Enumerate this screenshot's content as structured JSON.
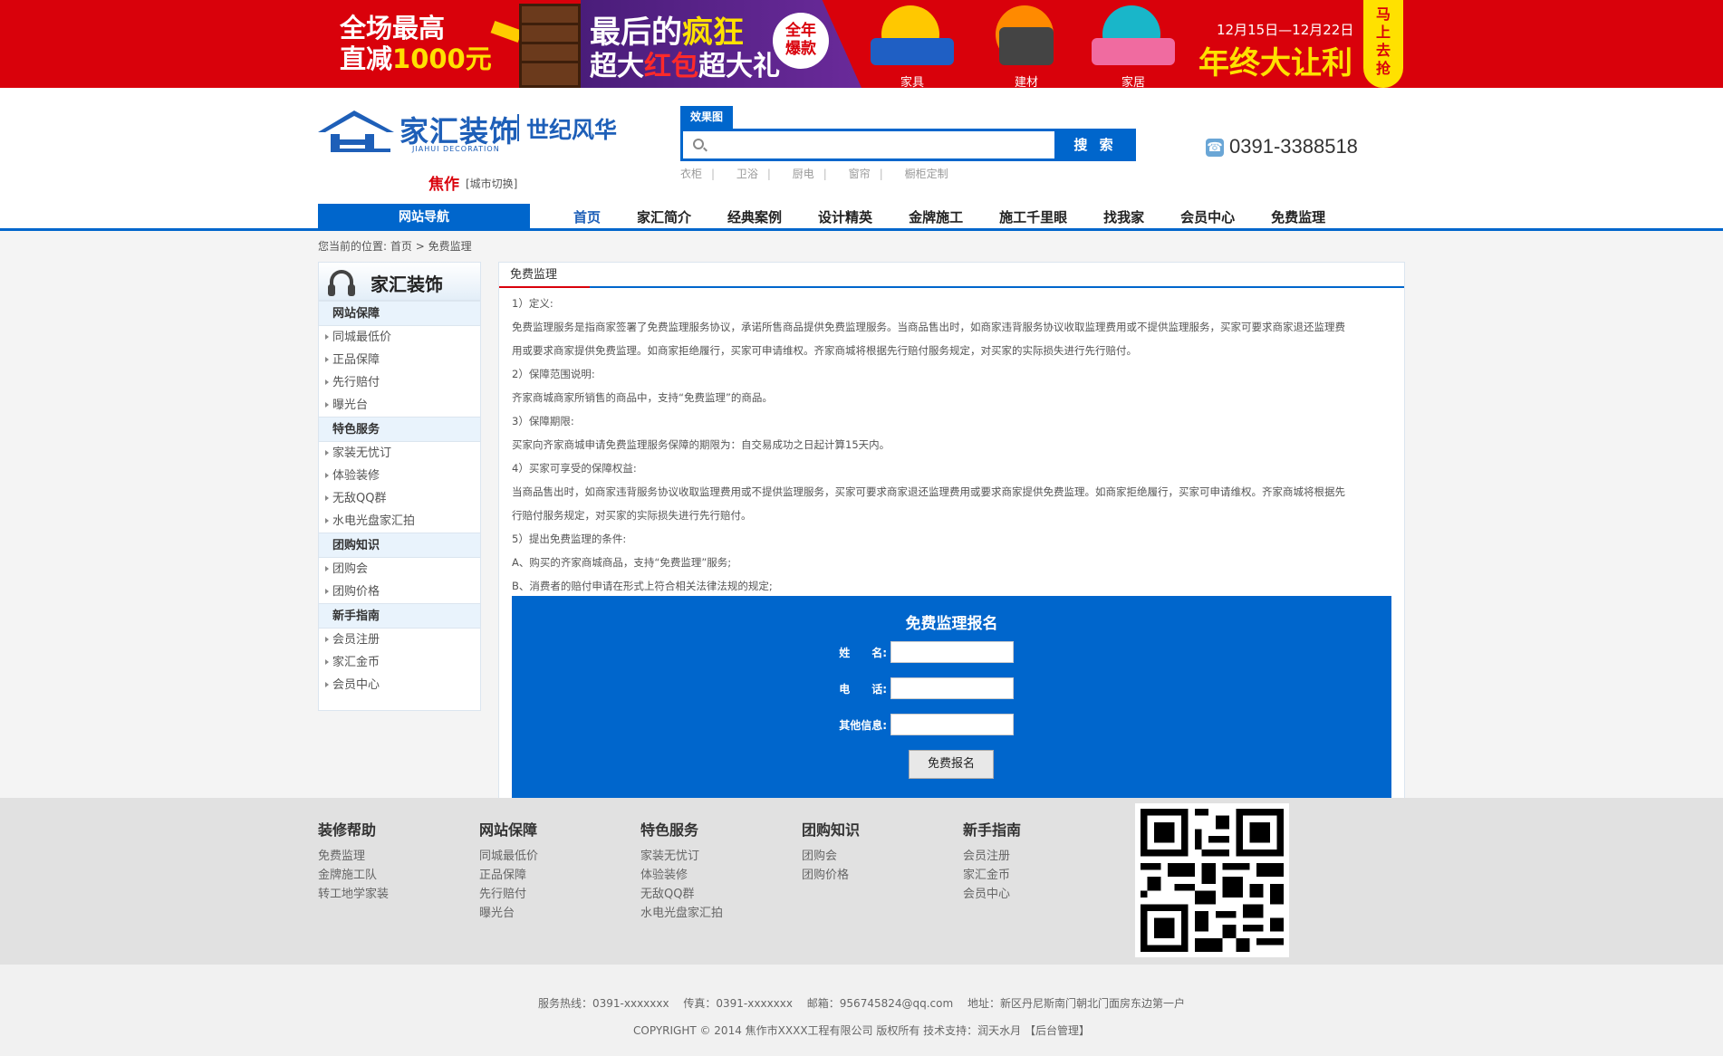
{
  "banner": {
    "promo_line1": "全场最高",
    "promo_line2_prefix": "直减",
    "promo_line2_amount": "1000元",
    "headline_a": "最后的",
    "headline_b": "疯狂",
    "subline_a": "超大",
    "subline_b": "红包",
    "subline_c": "超大礼",
    "badge_line1": "全年",
    "badge_line2": "爆款",
    "products": [
      "家具",
      "建材",
      "家居"
    ],
    "date_range": "12月15日—12月22日",
    "slogan": "年终大让利",
    "side_cta": "马上去抢"
  },
  "header": {
    "logo_name": "家汇装饰",
    "logo_sub": "世纪风华",
    "logo_en": "JIAHUI    DECORATION",
    "city": "焦作",
    "city_switch": "[城市切换]",
    "search_tab": "效果图",
    "search_placeholder": "",
    "search_button": "搜 索",
    "hot_words": [
      "衣柜",
      "卫浴",
      "厨电",
      "窗帘",
      "橱柜定制"
    ],
    "phone": "0391-3388518",
    "nav_label": "网站导航",
    "nav": [
      "首页",
      "家汇简介",
      "经典案例",
      "设计精英",
      "金牌施工",
      "施工千里眼",
      "找我家",
      "会员中心",
      "免费监理"
    ]
  },
  "breadcrumb": {
    "prefix": "您当前的位置:",
    "home": "首页",
    "sep": ">",
    "current": "免费监理"
  },
  "sidebar": {
    "title": "家汇装饰",
    "sections": [
      {
        "name": "网站保障",
        "items": [
          "同城最低价",
          "正品保障",
          "先行赔付",
          "曝光台"
        ]
      },
      {
        "name": "特色服务",
        "items": [
          "家装无忧订",
          "体验装修",
          "无敌QQ群",
          "水电光盘家汇拍"
        ]
      },
      {
        "name": "团购知识",
        "items": [
          "团购会",
          "团购价格"
        ]
      },
      {
        "name": "新手指南",
        "items": [
          "会员注册",
          "家汇金币",
          "会员中心"
        ]
      }
    ]
  },
  "content": {
    "title": "免费监理",
    "paragraphs": [
      "1）定义:",
      "免费监理服务是指商家签署了免费监理服务协议，承诺所售商品提供免费监理服务。当商品售出时，如商家违背服务协议收取监理费用或不提供监理服务，买家可要求商家退还监理费",
      "用或要求商家提供免费监理。如商家拒绝履行，买家可申请维权。齐家商城将根据先行赔付服务规定，对买家的实际损失进行先行赔付。",
      "2）保障范围说明:",
      "齐家商城商家所销售的商品中，支持“免费监理”的商品。",
      "3）保障期限:",
      "买家向齐家商城申请免费监理服务保障的期限为：自交易成功之日起计算15天内。",
      "4）买家可享受的保障权益:",
      "当商品售出时，如商家违背服务协议收取监理费用或不提供监理服务，买家可要求商家退还监理费用或要求商家提供免费监理。如商家拒绝履行，买家可申请维权。齐家商城将根据先",
      "行赔付服务规定，对买家的实际损失进行先行赔付。",
      "5）提出免费监理的条件:",
      "A、购买的齐家商城商品，支持“免费监理”服务;",
      "B、消费者的赔付申请在形式上符合相关法律法规的规定;"
    ]
  },
  "form": {
    "title": "免费监理报名",
    "name_label": "姓　　名:",
    "phone_label": "电　　话:",
    "other_label": "其他信息:",
    "submit": "免费报名"
  },
  "footer_links": [
    {
      "title": "装修帮助",
      "items": [
        "免费监理",
        "金牌施工队",
        "转工地学家装"
      ]
    },
    {
      "title": "网站保障",
      "items": [
        "同城最低价",
        "正品保障",
        "先行赔付",
        "曝光台"
      ]
    },
    {
      "title": "特色服务",
      "items": [
        "家装无忧订",
        "体验装修",
        "无敌QQ群",
        "水电光盘家汇拍"
      ]
    },
    {
      "title": "团购知识",
      "items": [
        "团购会",
        "团购价格"
      ]
    },
    {
      "title": "新手指南",
      "items": [
        "会员注册",
        "家汇金币",
        "会员中心"
      ]
    }
  ],
  "footer": {
    "line1": "服务热线：0391-xxxxxxx　 传真：0391-xxxxxxx　  邮箱：956745824@qq.com　  地址：新区丹尼斯南门朝北门面房东边第一户",
    "line2": "COPYRIGHT © 2014 焦作市XXXX工程有限公司 版权所有 技术支持：润天水月 【后台管理】"
  },
  "colors": {
    "brand_blue": "#0066cc",
    "banner_red": "#d9010b",
    "accent_yellow": "#ffe100"
  }
}
